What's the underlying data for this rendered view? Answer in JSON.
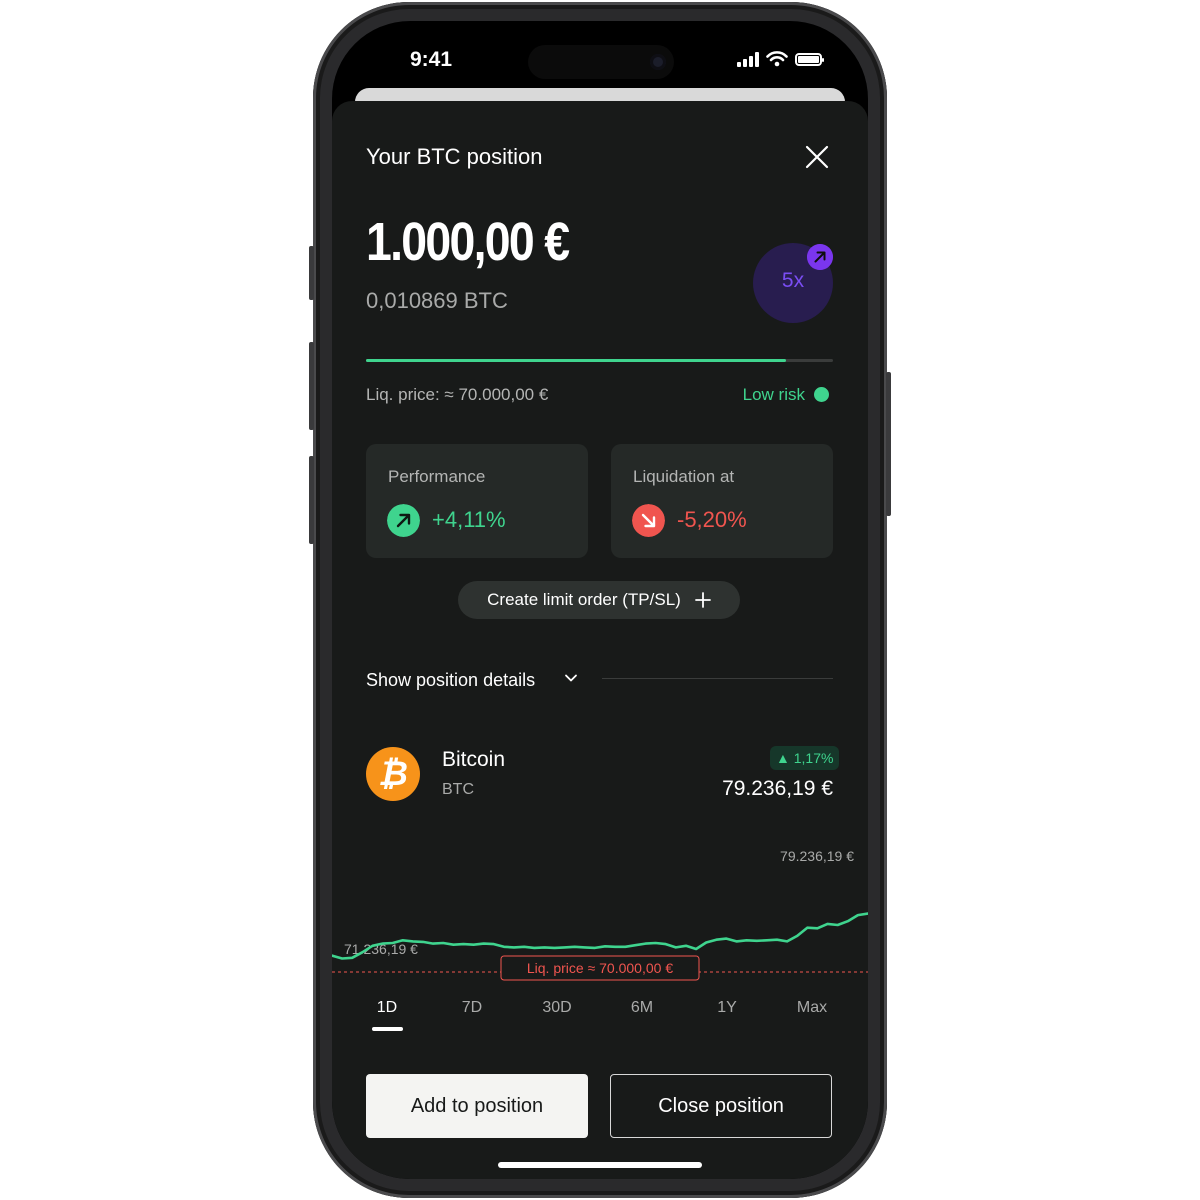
{
  "status": {
    "time": "9:41"
  },
  "header": {
    "title": "Your BTC position"
  },
  "position": {
    "amount": "1.000,00 €",
    "amount_btc": "0,010869 BTC",
    "leverage": "5x",
    "risk_progress_pct": 90,
    "liq_price_label": "Liq. price: ≈ 70.000,00 €",
    "risk_label": "Low risk"
  },
  "cards": {
    "performance": {
      "label": "Performance",
      "value": "+4,11%"
    },
    "liquidation": {
      "label": "Liquidation at",
      "value": "-5,20%"
    }
  },
  "actions": {
    "limit_order_label": "Create limit order (TP/SL)",
    "show_details_label": "Show position details",
    "add_label": "Add to position",
    "close_label": "Close position"
  },
  "asset": {
    "name": "Bitcoin",
    "symbol": "BTC",
    "change": "▲ 1,17%",
    "price": "79.236,19 €"
  },
  "chart_data": {
    "type": "line",
    "title": "",
    "xlabel": "",
    "ylabel": "",
    "range": "1D",
    "high_label": "79.236,19 €",
    "low_label": "71.236,19 €",
    "liq_label": "Liq. price ≈ 70.000,00 €",
    "ylim": [
      70000,
      79236.19
    ],
    "series": [
      {
        "values": [
          71500,
          71236.19,
          71300,
          71800,
          72400,
          72600,
          72650,
          72900,
          72800,
          72750,
          72600,
          72650,
          72500,
          72550,
          72500,
          72600,
          72550,
          72300,
          72250,
          72300,
          72200,
          72250,
          72200,
          72250,
          72300,
          72250,
          72200,
          72350,
          72300,
          72300,
          72450,
          72600,
          72650,
          72550,
          72250,
          72400,
          72100,
          72700,
          72950,
          73050,
          72800,
          72900,
          72850,
          72900,
          72950,
          72800,
          73300,
          74050,
          74000,
          74400,
          74300,
          74650,
          75200,
          75350
        ]
      }
    ],
    "liq_level": 70000
  },
  "ranges": [
    "1D",
    "7D",
    "30D",
    "6M",
    "1Y",
    "Max"
  ],
  "colors": {
    "accent_green": "#3fd48e",
    "accent_red": "#f0554f",
    "leverage_purple": "#7a36ee",
    "sheet_bg": "#181a19"
  }
}
